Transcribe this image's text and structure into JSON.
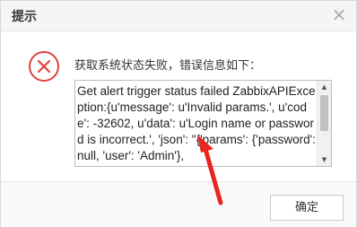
{
  "dialog": {
    "title": "提示",
    "close_icon": "close-icon",
    "close_glyph": "×",
    "error_icon": "error-circle-x-icon",
    "error_color": "#e0413a",
    "message": "获取系统状态失败，错误信息如下：",
    "error_detail": "Get alert trigger status failed ZabbixAPIException:{u'message': u'Invalid params.', u'code': -32602, u'data': u'Login name or password is incorrect.', 'json': \"{'params': {'password': null, 'user': 'Admin'},",
    "ok_label": "确定"
  },
  "scrollbar": {
    "up_glyph": "▲",
    "down_glyph": "▼"
  },
  "annotation": {
    "arrow_color": "#e8261f"
  }
}
